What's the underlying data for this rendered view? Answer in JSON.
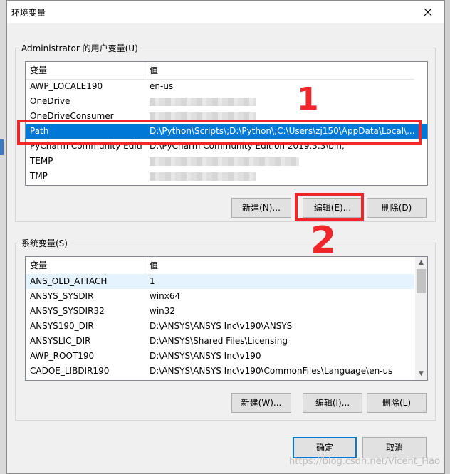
{
  "window": {
    "title": "环境变量",
    "close_glyph": "✕"
  },
  "user_group": {
    "label": "Administrator 的用户变量(U)",
    "headers": [
      "变量",
      "值"
    ],
    "rows": [
      {
        "name": "AWP_LOCALE190",
        "value": "en-us",
        "blurred": false
      },
      {
        "name": "OneDrive",
        "value": "",
        "blurred": true
      },
      {
        "name": "OneDriveConsumer",
        "value": "",
        "blurred": true
      },
      {
        "name": "Path",
        "value": "D:\\Python\\Scripts\\;D:\\Python\\;C:\\Users\\zj150\\AppData\\Local\\...",
        "blurred": false,
        "selected": true
      },
      {
        "name": "PyCharm Community Editi...",
        "value": "D:\\PyCharm Community Edition 2019.3.3\\bin;",
        "blurred": false
      },
      {
        "name": "TEMP",
        "value": "",
        "blurred": true
      },
      {
        "name": "TMP",
        "value": "",
        "blurred": true
      }
    ],
    "buttons": {
      "new": "新建(N)...",
      "edit": "编辑(E)...",
      "delete": "删除(D)"
    }
  },
  "system_group": {
    "label": "系统变量(S)",
    "headers": [
      "变量",
      "值"
    ],
    "rows": [
      {
        "name": "ANS_OLD_ATTACH",
        "value": "1",
        "hover": true
      },
      {
        "name": "ANSYS_SYSDIR",
        "value": "winx64"
      },
      {
        "name": "ANSYS_SYSDIR32",
        "value": "win32"
      },
      {
        "name": "ANSYS190_DIR",
        "value": "D:\\ANSYS\\ANSYS Inc\\v190\\ANSYS"
      },
      {
        "name": "ANSYSLIC_DIR",
        "value": "D:\\ANSYS\\Shared Files\\Licensing"
      },
      {
        "name": "AWP_ROOT190",
        "value": "D:\\ANSYS\\ANSYS Inc\\v190"
      },
      {
        "name": "CADOE_LIBDIR190",
        "value": "D:\\ANSYS\\ANSYS Inc\\v190\\CommonFiles\\Language\\en-us"
      }
    ],
    "buttons": {
      "new": "新建(W)...",
      "edit": "编辑(I)...",
      "delete": "删除(L)"
    }
  },
  "footer": {
    "ok": "确定",
    "cancel": "取消"
  },
  "annotations": {
    "one": "1",
    "two": "2",
    "color": "#f0262b"
  },
  "watermark": "https://blog.csdn.net/Vicent_Hao"
}
